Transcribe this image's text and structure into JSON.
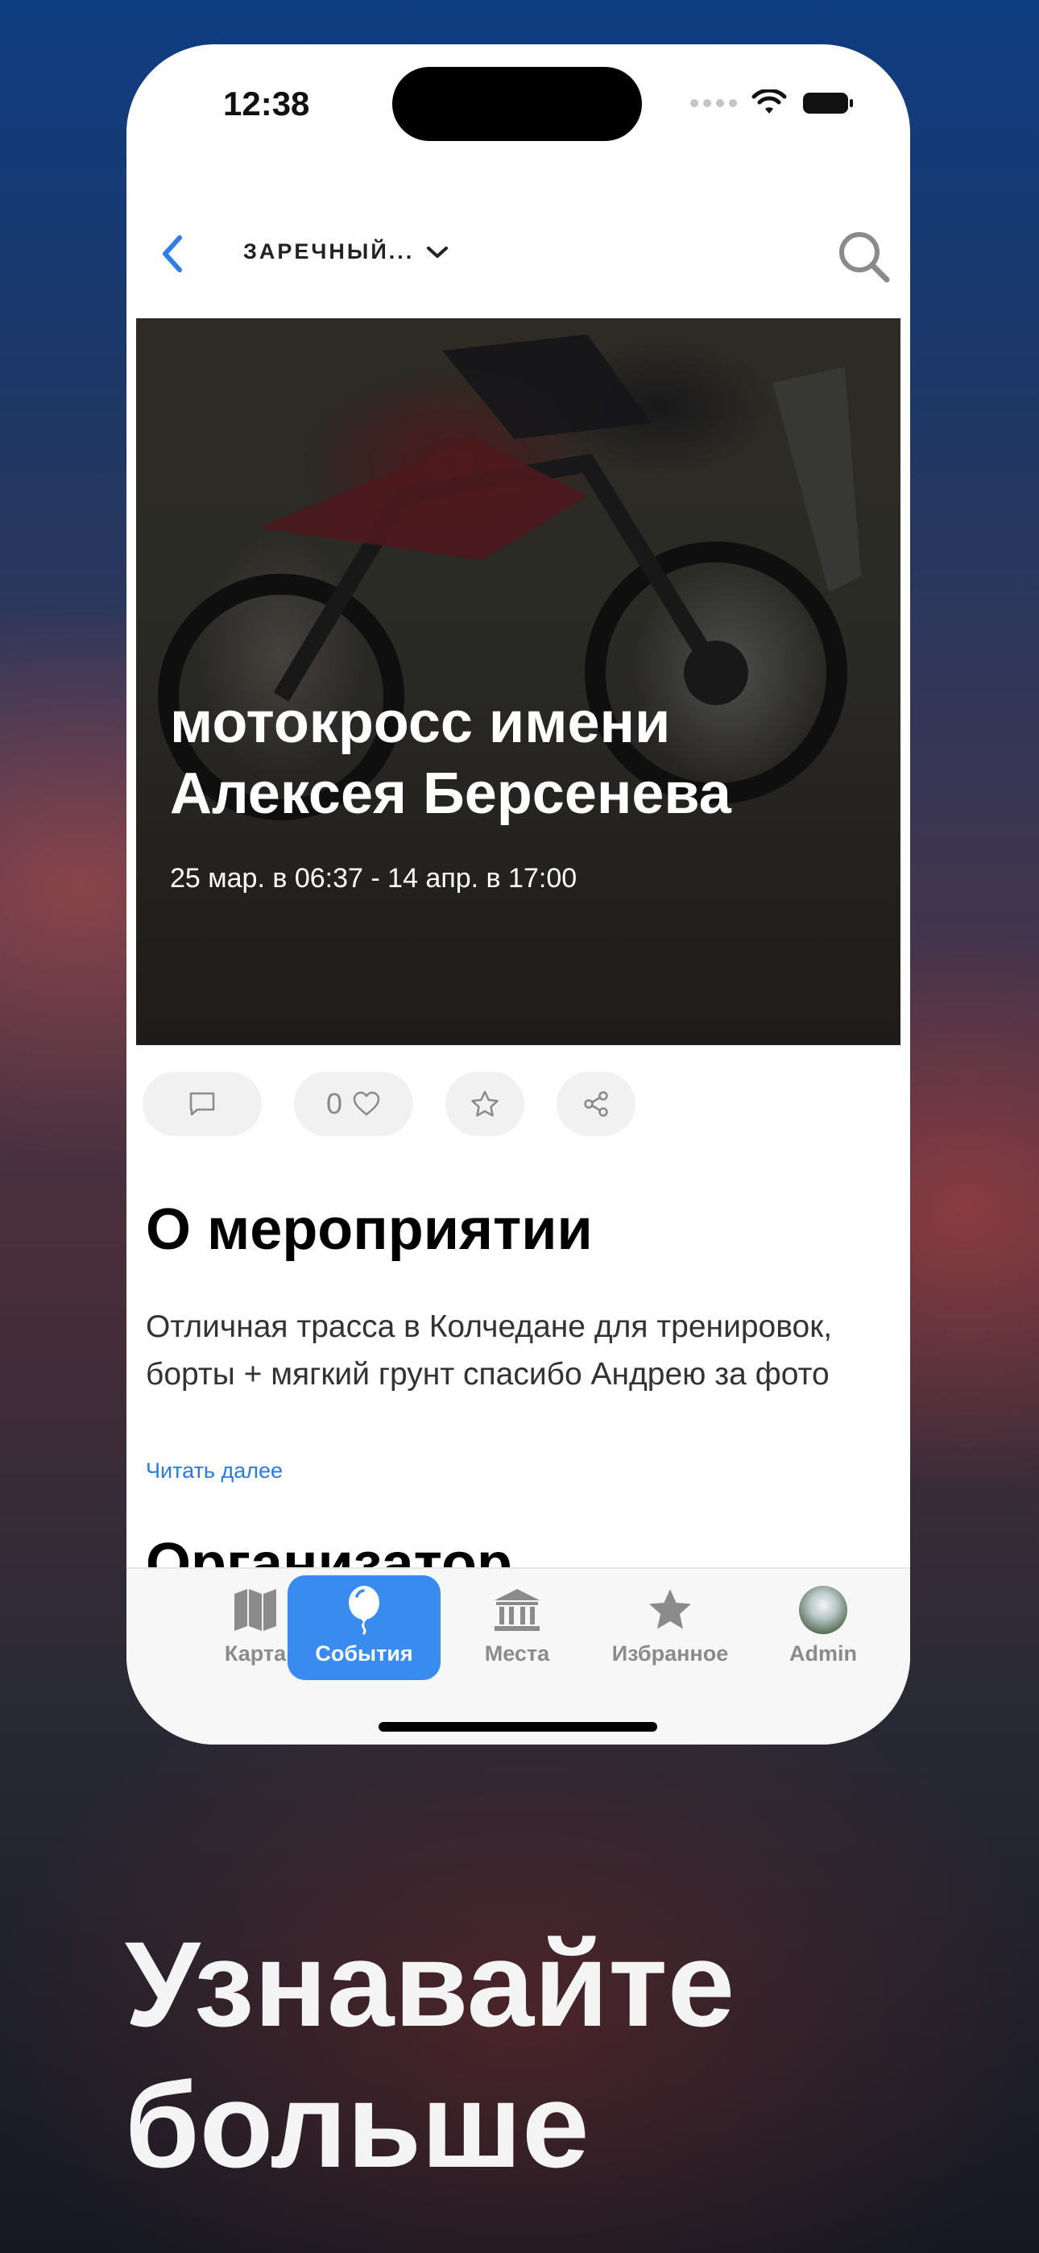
{
  "status_bar": {
    "time": "12:38"
  },
  "navbar": {
    "city": "ЗАРЕЧНЫЙ..."
  },
  "event": {
    "title": "мотокросс имени Алексея Берсенева",
    "dates": "25 мар. в 06:37 - 14 апр. в 17:00",
    "likes": "0"
  },
  "about": {
    "title": "О мероприятии",
    "text": "Отличная трасса в Колчедане для тренировок, борты + мягкий грунт спасибо Андрею за фото",
    "read_more": "Читать далее"
  },
  "organizer": {
    "title": "Организатор"
  },
  "tabs": [
    {
      "label": "Карта",
      "icon": "map-icon"
    },
    {
      "label": "События",
      "icon": "balloon-icon",
      "active": true
    },
    {
      "label": "Места",
      "icon": "landmark-icon"
    },
    {
      "label": "Избранное",
      "icon": "star-icon"
    },
    {
      "label": "Admin",
      "icon": "avatar"
    }
  ],
  "tagline": "Узнавайте больше",
  "colors": {
    "accent": "#3a8bf0",
    "link": "#2a7ae2"
  }
}
